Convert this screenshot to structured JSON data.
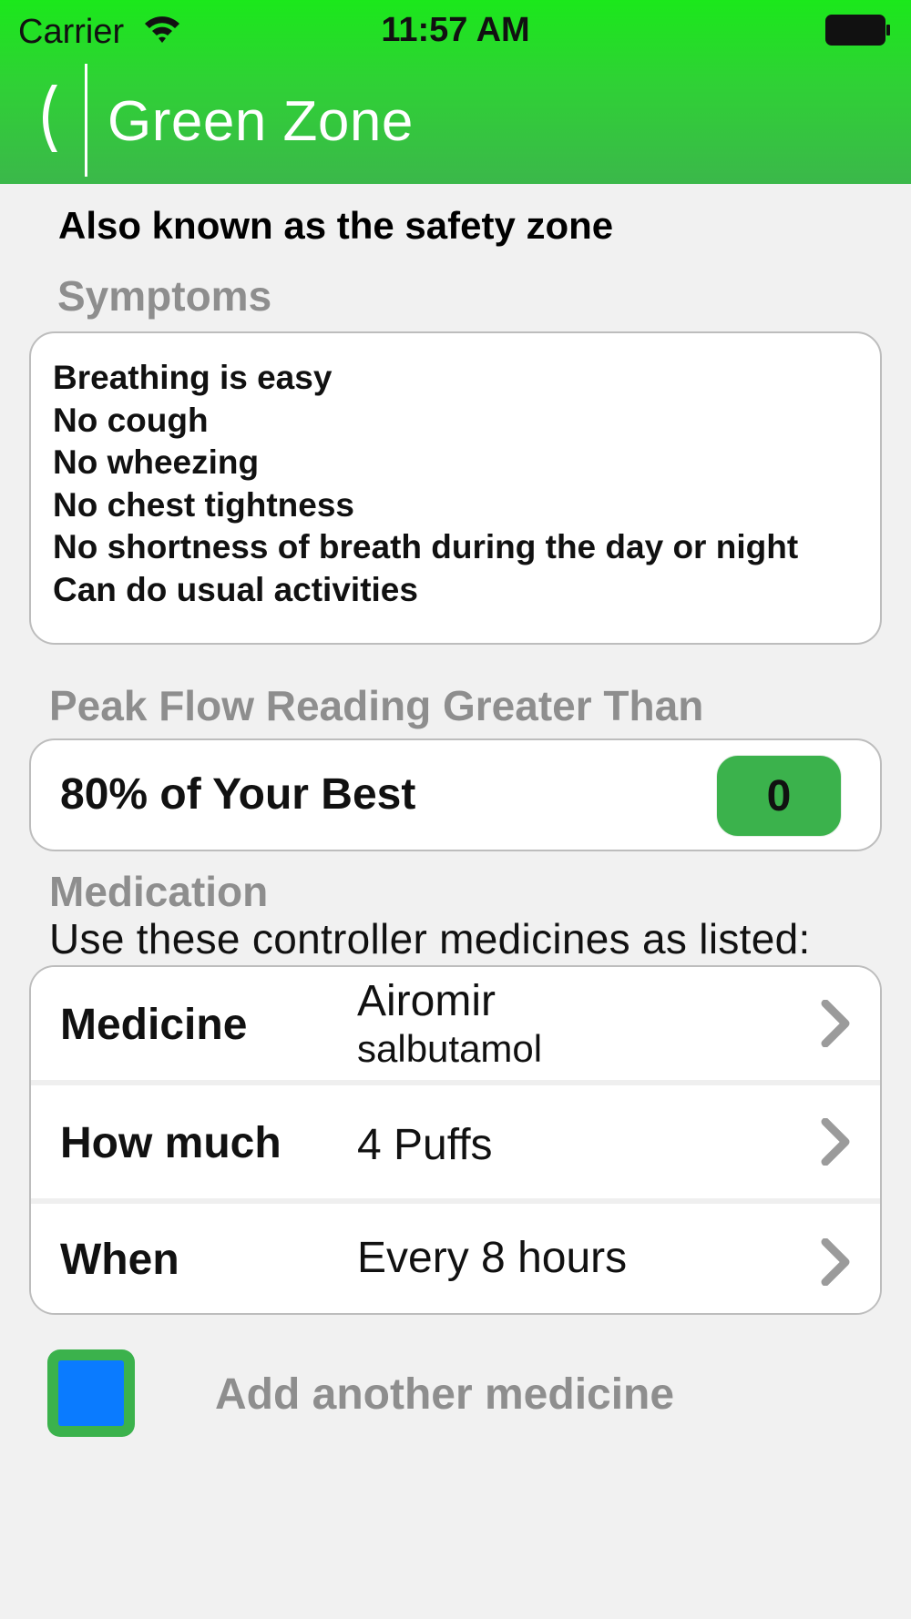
{
  "status_bar": {
    "carrier": "Carrier",
    "time": "11:57 AM",
    "icons": [
      "wifi-icon",
      "battery-icon"
    ]
  },
  "nav": {
    "back_icon": "chevron-left-icon",
    "title": "Green Zone"
  },
  "colors": {
    "header_green": "#2fd135",
    "accent_green": "#3bb24c",
    "checkbox_blue": "#0a7bff",
    "section_gray": "#8e8e8e"
  },
  "subtitle": "Also known as the safety zone",
  "symptoms": {
    "label": "Symptoms",
    "items": [
      "Breathing is easy",
      "No cough",
      "No wheezing",
      "No chest tightness",
      "No shortness of breath during the day or night",
      "Can do usual activities"
    ]
  },
  "peak_flow": {
    "label": "Peak Flow Reading Greater Than",
    "text": "80% of Your Best",
    "value": "0"
  },
  "medication": {
    "label": "Medication",
    "instructions": "Use these controller medicines as listed:",
    "rows": [
      {
        "label": "Medicine",
        "value": "Airomir",
        "secondary": "salbutamol"
      },
      {
        "label": "How much",
        "value": "4 Puffs"
      },
      {
        "label": "When",
        "value": "Every 8 hours"
      }
    ],
    "chevron_icon": "chevron-right-icon"
  },
  "add_medicine": {
    "label": "Add another medicine",
    "checked": false
  }
}
